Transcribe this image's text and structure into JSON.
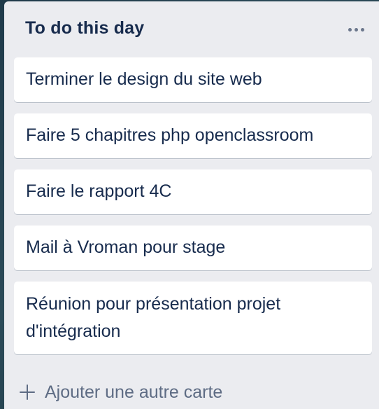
{
  "list": {
    "title": "To do this day",
    "menu_icon": "more-horizontal-icon",
    "cards": [
      {
        "text": "Terminer le design du site web"
      },
      {
        "text": "Faire 5 chapitres php openclassroom"
      },
      {
        "text": "Faire le rapport 4C"
      },
      {
        "text": "Mail à Vroman pour stage"
      },
      {
        "text": "Réunion pour présentation projet d'intégration"
      }
    ],
    "add_card_label": "Ajouter une autre carte",
    "add_card_icon": "plus-icon"
  },
  "colors": {
    "list_background": "#ebecf0",
    "card_background": "#ffffff",
    "title_text": "#172b4d",
    "secondary_text": "#5e6c84"
  }
}
